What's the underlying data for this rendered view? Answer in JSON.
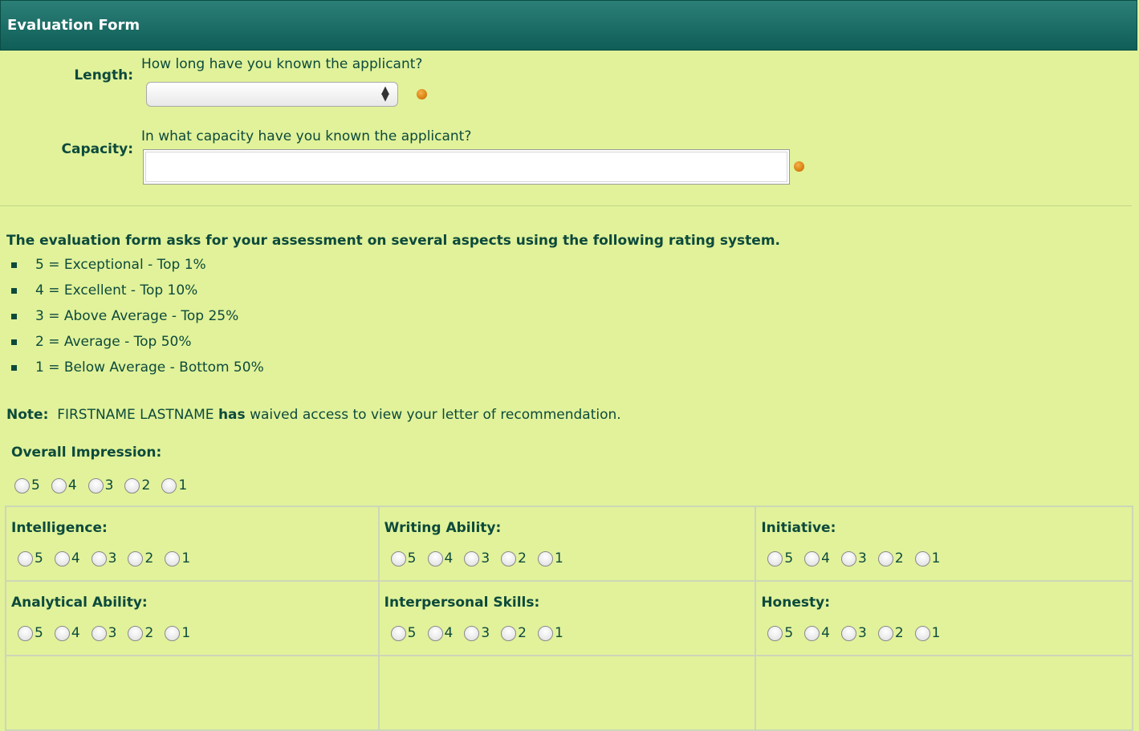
{
  "header": {
    "title": "Evaluation Form"
  },
  "length": {
    "label": "Length:",
    "question": "How long have you known the applicant?",
    "selected_value": ""
  },
  "capacity": {
    "label": "Capacity:",
    "question": "In what capacity have you known the applicant?",
    "value": ""
  },
  "intro": "The evaluation form asks for your assessment on several aspects using the following rating system.",
  "ratings": [
    "5 = Exceptional - Top 1%",
    "4 = Excellent - Top 10%",
    "3 = Above Average - Top 25%",
    "2 = Average - Top 50%",
    "1 = Below Average - Bottom 50%"
  ],
  "note": {
    "label": "Note:",
    "name": "FIRSTNAME LASTNAME",
    "has": "has",
    "rest": "waived access to view your letter of recommendation."
  },
  "overall": {
    "label": "Overall Impression:"
  },
  "options": [
    "5",
    "4",
    "3",
    "2",
    "1"
  ],
  "aspects": [
    {
      "label": "Intelligence:"
    },
    {
      "label": "Writing Ability:"
    },
    {
      "label": "Initiative:"
    },
    {
      "label": "Analytical Ability:"
    },
    {
      "label": "Interpersonal Skills:"
    },
    {
      "label": "Honesty:"
    }
  ],
  "colors": {
    "background": "#e1f29a",
    "header": "#1a6e67",
    "text": "#0d4a3c",
    "required_dot": "#d57a0b"
  }
}
